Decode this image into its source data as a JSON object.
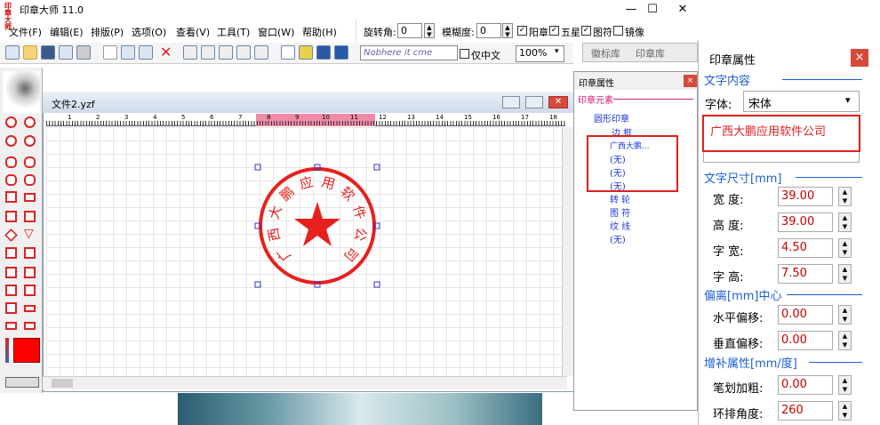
{
  "app": {
    "title": "印章大师 11.0",
    "icon_text": "印章大师"
  },
  "window_buttons": [
    "—",
    "☐",
    "✕"
  ],
  "menu": [
    "文件(F)",
    "编辑(E)",
    "排版(P)",
    "选项(O)",
    "查看(V)",
    "工具(T)",
    "窗口(W)",
    "帮助(H)"
  ],
  "top_controls": {
    "rotate_label": "旋转角:",
    "rotate_value": "0",
    "blur_label": "模糊度:",
    "blur_value": "0",
    "yang_label": "阳章",
    "star_label": "五星",
    "pattern_label": "图符",
    "mirror_label": "镜像",
    "font_preview": "Nobhere  it  cme",
    "cn_only_label": "仅中文",
    "zoom": "100%",
    "lib_tabs": [
      "徽标库",
      "印章库"
    ]
  },
  "doc": {
    "title": "文件2.yzf",
    "ruler_ticks": [
      "1",
      "2",
      "3",
      "4",
      "5",
      "6",
      "7",
      "8",
      "9",
      "10",
      "11",
      "12",
      "13",
      "14",
      "15",
      "16",
      "17",
      "18"
    ],
    "seal_text": [
      "广",
      "西",
      "大",
      "鹏",
      "应",
      "用",
      "软",
      "件",
      "公",
      "司"
    ]
  },
  "tree": {
    "header": "印章属性",
    "section": "印章元素",
    "root": "圆形印章",
    "items": [
      "边 框",
      "广西大鹏...",
      "(无)",
      "(无)",
      "(无)",
      "转 轮",
      "图 符",
      "纹 线",
      "(无)"
    ]
  },
  "props": {
    "header": "印章属性",
    "close": "×",
    "sec_text": "文字内容",
    "font_label": "字体:",
    "font_value": "宋体",
    "text_value": "广西大鹏应用软件公司",
    "sec_size": "文字尺寸[mm]",
    "width_label": "宽    度:",
    "width_value": "39.00",
    "height_label": "高    度:",
    "height_value": "39.00",
    "charw_label": "字    宽:",
    "charw_value": "4.50",
    "charh_label": "字    高:",
    "charh_value": "7.50",
    "sec_offset": "偏离[mm]中心",
    "hoff_label": "水平偏移:",
    "hoff_value": "0.00",
    "voff_label": "垂直偏移:",
    "voff_value": "0.00",
    "sec_extra": "增补属性[mm/度]",
    "bold_label": "笔划加粗:",
    "bold_value": "0.00",
    "angle_label": "环排角度:",
    "angle_value": "260"
  },
  "colors": {
    "accent_red": "#e02020",
    "seal_red": "#e8201c",
    "section_blue": "#1a5fd2"
  }
}
